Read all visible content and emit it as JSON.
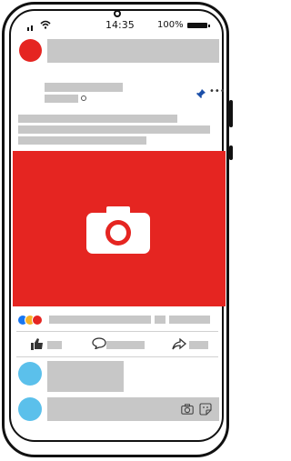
{
  "status_bar": {
    "time": "14:35",
    "battery_percent": "100%",
    "signal_icon": "signal-icon",
    "wifi_icon": "wifi-icon",
    "battery_icon": "battery-icon"
  },
  "post": {
    "author_avatar_color": "#e52521",
    "header_icons": [
      "globe-icon",
      "pin-icon",
      "more-icon"
    ],
    "media_color": "#e52521",
    "media_icon": "camera-icon"
  },
  "reactions": {
    "icons": [
      "like-icon",
      "haha-icon",
      "love-icon"
    ],
    "colors": [
      "#1877f2",
      "#f7b125",
      "#e52521"
    ]
  },
  "actions": {
    "icons": [
      "like-icon",
      "comment-icon",
      "share-icon"
    ]
  },
  "comments": {
    "avatar_color": "#5bc0eb",
    "composer_icons": [
      "camera-icon",
      "sticker-icon"
    ]
  }
}
